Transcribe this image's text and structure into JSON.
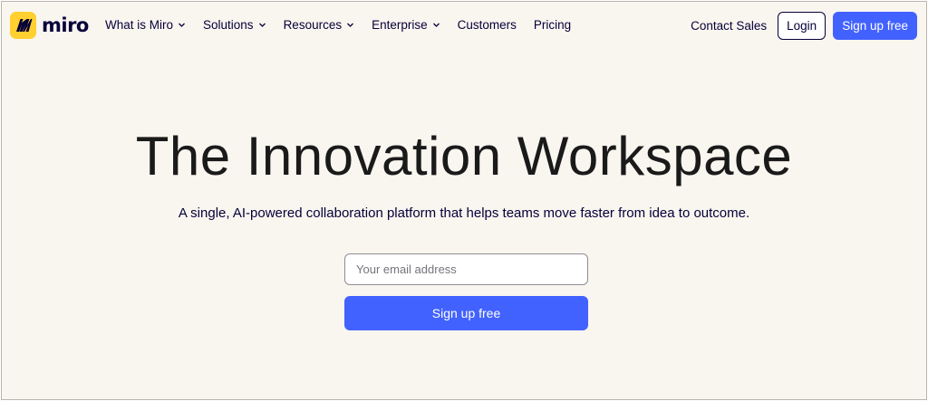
{
  "brand": {
    "name": "miro",
    "logo_color": "#ffd02f"
  },
  "nav": {
    "menu": [
      {
        "label": "What is Miro",
        "dropdown": true
      },
      {
        "label": "Solutions",
        "dropdown": true
      },
      {
        "label": "Resources",
        "dropdown": true
      },
      {
        "label": "Enterprise",
        "dropdown": true
      },
      {
        "label": "Customers",
        "dropdown": false
      },
      {
        "label": "Pricing",
        "dropdown": false
      }
    ],
    "contact_sales": "Contact Sales",
    "login": "Login",
    "signup": "Sign up free"
  },
  "hero": {
    "title": "The Innovation Workspace",
    "subtitle": "A single, AI-powered collaboration platform that helps teams move faster from idea to outcome.",
    "email_placeholder": "Your email address",
    "email_value": "",
    "signup_button": "Sign up free"
  },
  "colors": {
    "background": "#f9f5ef",
    "accent": "#4262ff",
    "text": "#050038"
  }
}
